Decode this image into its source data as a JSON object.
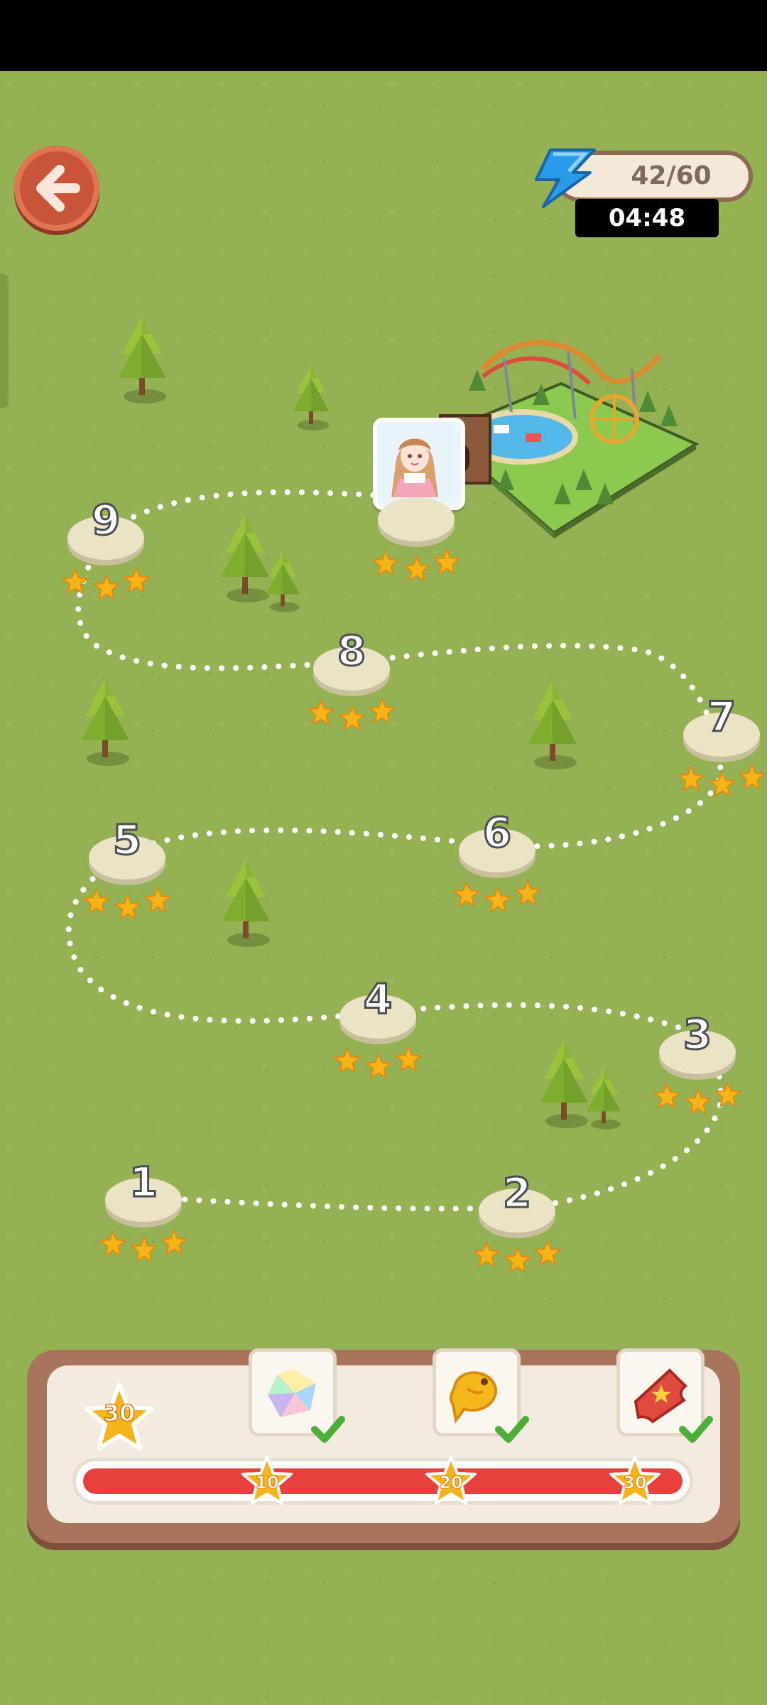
{
  "energy": {
    "value": "42/60",
    "timer": "04:48"
  },
  "levels": [
    {
      "number": "1",
      "stars": 3
    },
    {
      "number": "2",
      "stars": 3
    },
    {
      "number": "3",
      "stars": 3
    },
    {
      "number": "4",
      "stars": 3
    },
    {
      "number": "5",
      "stars": 3
    },
    {
      "number": "6",
      "stars": 3
    },
    {
      "number": "7",
      "stars": 3
    },
    {
      "number": "8",
      "stars": 3
    },
    {
      "number": "9",
      "stars": 3
    },
    {
      "number": "",
      "stars": 3
    }
  ],
  "rewards": {
    "total_stars": "30",
    "progress": 1.0,
    "milestones": [
      {
        "stars": "10",
        "reward": "rainbow-gem-icon",
        "claimed": true
      },
      {
        "stars": "20",
        "reward": "golden-fish-icon",
        "claimed": true
      },
      {
        "stars": "30",
        "reward": "red-ticket-icon",
        "claimed": true
      }
    ]
  },
  "colors": {
    "grass": "#94b154",
    "back_button": "#c8553a",
    "progress_fill": "#e8413d",
    "star": "#f7b418",
    "check": "#4caf3a"
  }
}
